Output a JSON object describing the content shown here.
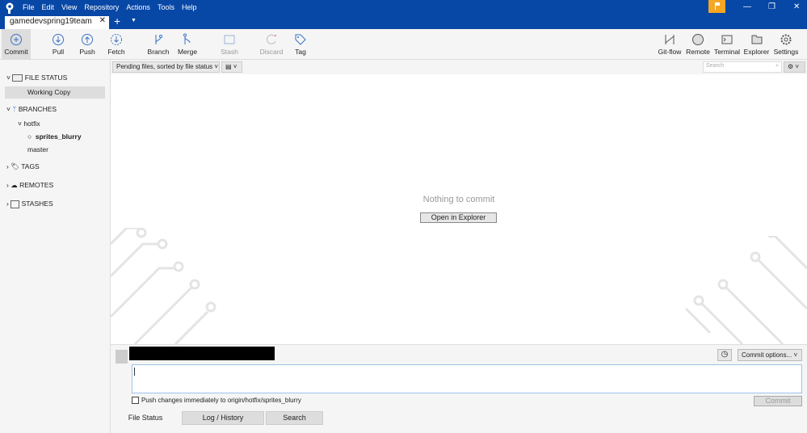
{
  "menu": [
    "File",
    "Edit",
    "View",
    "Repository",
    "Actions",
    "Tools",
    "Help"
  ],
  "tab": {
    "title": "gamedevspring19team",
    "close": "✕"
  },
  "toolbar": {
    "commit": "Commit",
    "pull": "Pull",
    "push": "Push",
    "fetch": "Fetch",
    "branch": "Branch",
    "merge": "Merge",
    "stash": "Stash",
    "discard": "Discard",
    "tag": "Tag",
    "gitflow": "Git-flow",
    "remote": "Remote",
    "terminal": "Terminal",
    "explorer": "Explorer",
    "settings": "Settings"
  },
  "filter": {
    "sort": "Pending files, sorted by file status",
    "search_placeholder": "Search"
  },
  "sidebar": {
    "file_status": "FILE STATUS",
    "working_copy": "Working Copy",
    "branches": "BRANCHES",
    "hotfix": "hotfix",
    "current_branch": "sprites_blurry",
    "master": "master",
    "tags": "TAGS",
    "remotes": "REMOTES",
    "stashes": "STASHES"
  },
  "main": {
    "empty": "Nothing to commit",
    "open_explorer": "Open in Explorer"
  },
  "commit": {
    "options": "Commit options...",
    "push_label": "Push changes immediately to origin/hotfix/sprites_blurry",
    "commit_button": "Commit"
  },
  "bottom_tabs": [
    "File Status",
    "Log / History",
    "Search"
  ]
}
